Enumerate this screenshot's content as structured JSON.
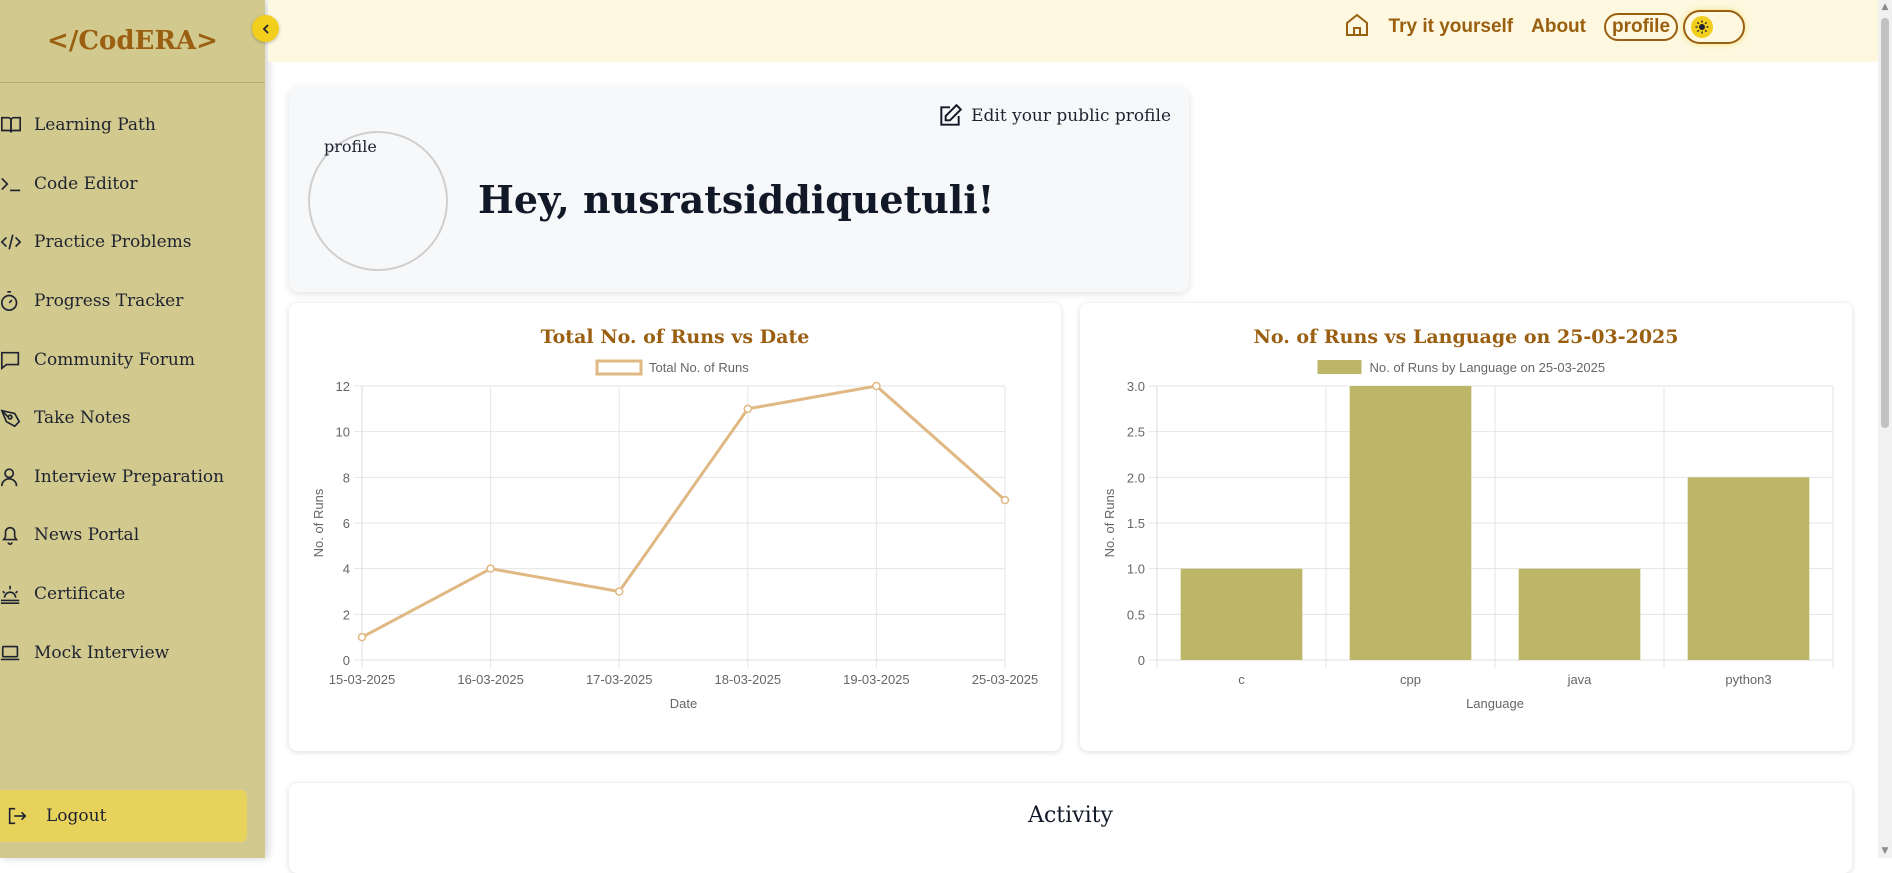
{
  "brand": "</CodERA>",
  "sidebar": {
    "items": [
      {
        "label": "Learning Path",
        "icon": "book-icon"
      },
      {
        "label": "Code Editor",
        "icon": "terminal-icon"
      },
      {
        "label": "Practice Problems",
        "icon": "code-icon"
      },
      {
        "label": "Progress Tracker",
        "icon": "timer-icon"
      },
      {
        "label": "Community Forum",
        "icon": "chat-icon"
      },
      {
        "label": "Take Notes",
        "icon": "pen-tool-icon"
      },
      {
        "label": "Interview Preparation",
        "icon": "user-icon"
      },
      {
        "label": "News Portal",
        "icon": "bell-icon"
      },
      {
        "label": "Certificate",
        "icon": "sunset-icon"
      },
      {
        "label": "Mock Interview",
        "icon": "laptop-icon"
      }
    ],
    "logout": "Logout"
  },
  "topbar": {
    "try_label": "Try it yourself",
    "about_label": "About",
    "profile_alt": "profile"
  },
  "profile": {
    "avatar_alt": "profile",
    "greeting": "Hey, nusratsiddiquetuli!",
    "edit_label": "Edit your public profile"
  },
  "activity": {
    "title": "Activity"
  },
  "colors": {
    "accent": "#9a5f10",
    "sidebar_bg": "#d1c98e",
    "line": "#e0b883",
    "bar": "#bdb567",
    "logout_bg": "#e7d25b"
  },
  "chart_data": [
    {
      "type": "line",
      "title": "Total No. of Runs vs Date",
      "legend": "Total No. of Runs",
      "xlabel": "Date",
      "ylabel": "No. of Runs",
      "categories": [
        "15-03-2025",
        "16-03-2025",
        "17-03-2025",
        "18-03-2025",
        "19-03-2025",
        "25-03-2025"
      ],
      "values": [
        1,
        4,
        3,
        11,
        12,
        7
      ],
      "ylim": [
        0,
        12
      ],
      "yticks": [
        "0",
        "2",
        "4",
        "6",
        "8",
        "10",
        "12"
      ],
      "grid": true,
      "legend_position": "top"
    },
    {
      "type": "bar",
      "title": "No. of Runs vs Language on 25-03-2025",
      "legend": "No. of Runs by Language on 25-03-2025",
      "xlabel": "Language",
      "ylabel": "No. of Runs",
      "categories": [
        "c",
        "cpp",
        "java",
        "python3"
      ],
      "values": [
        1,
        3,
        1,
        2
      ],
      "ylim": [
        0,
        3
      ],
      "yticks": [
        "0",
        "0.5",
        "1.0",
        "1.5",
        "2.0",
        "2.5",
        "3.0"
      ],
      "grid": true,
      "legend_position": "top"
    }
  ]
}
